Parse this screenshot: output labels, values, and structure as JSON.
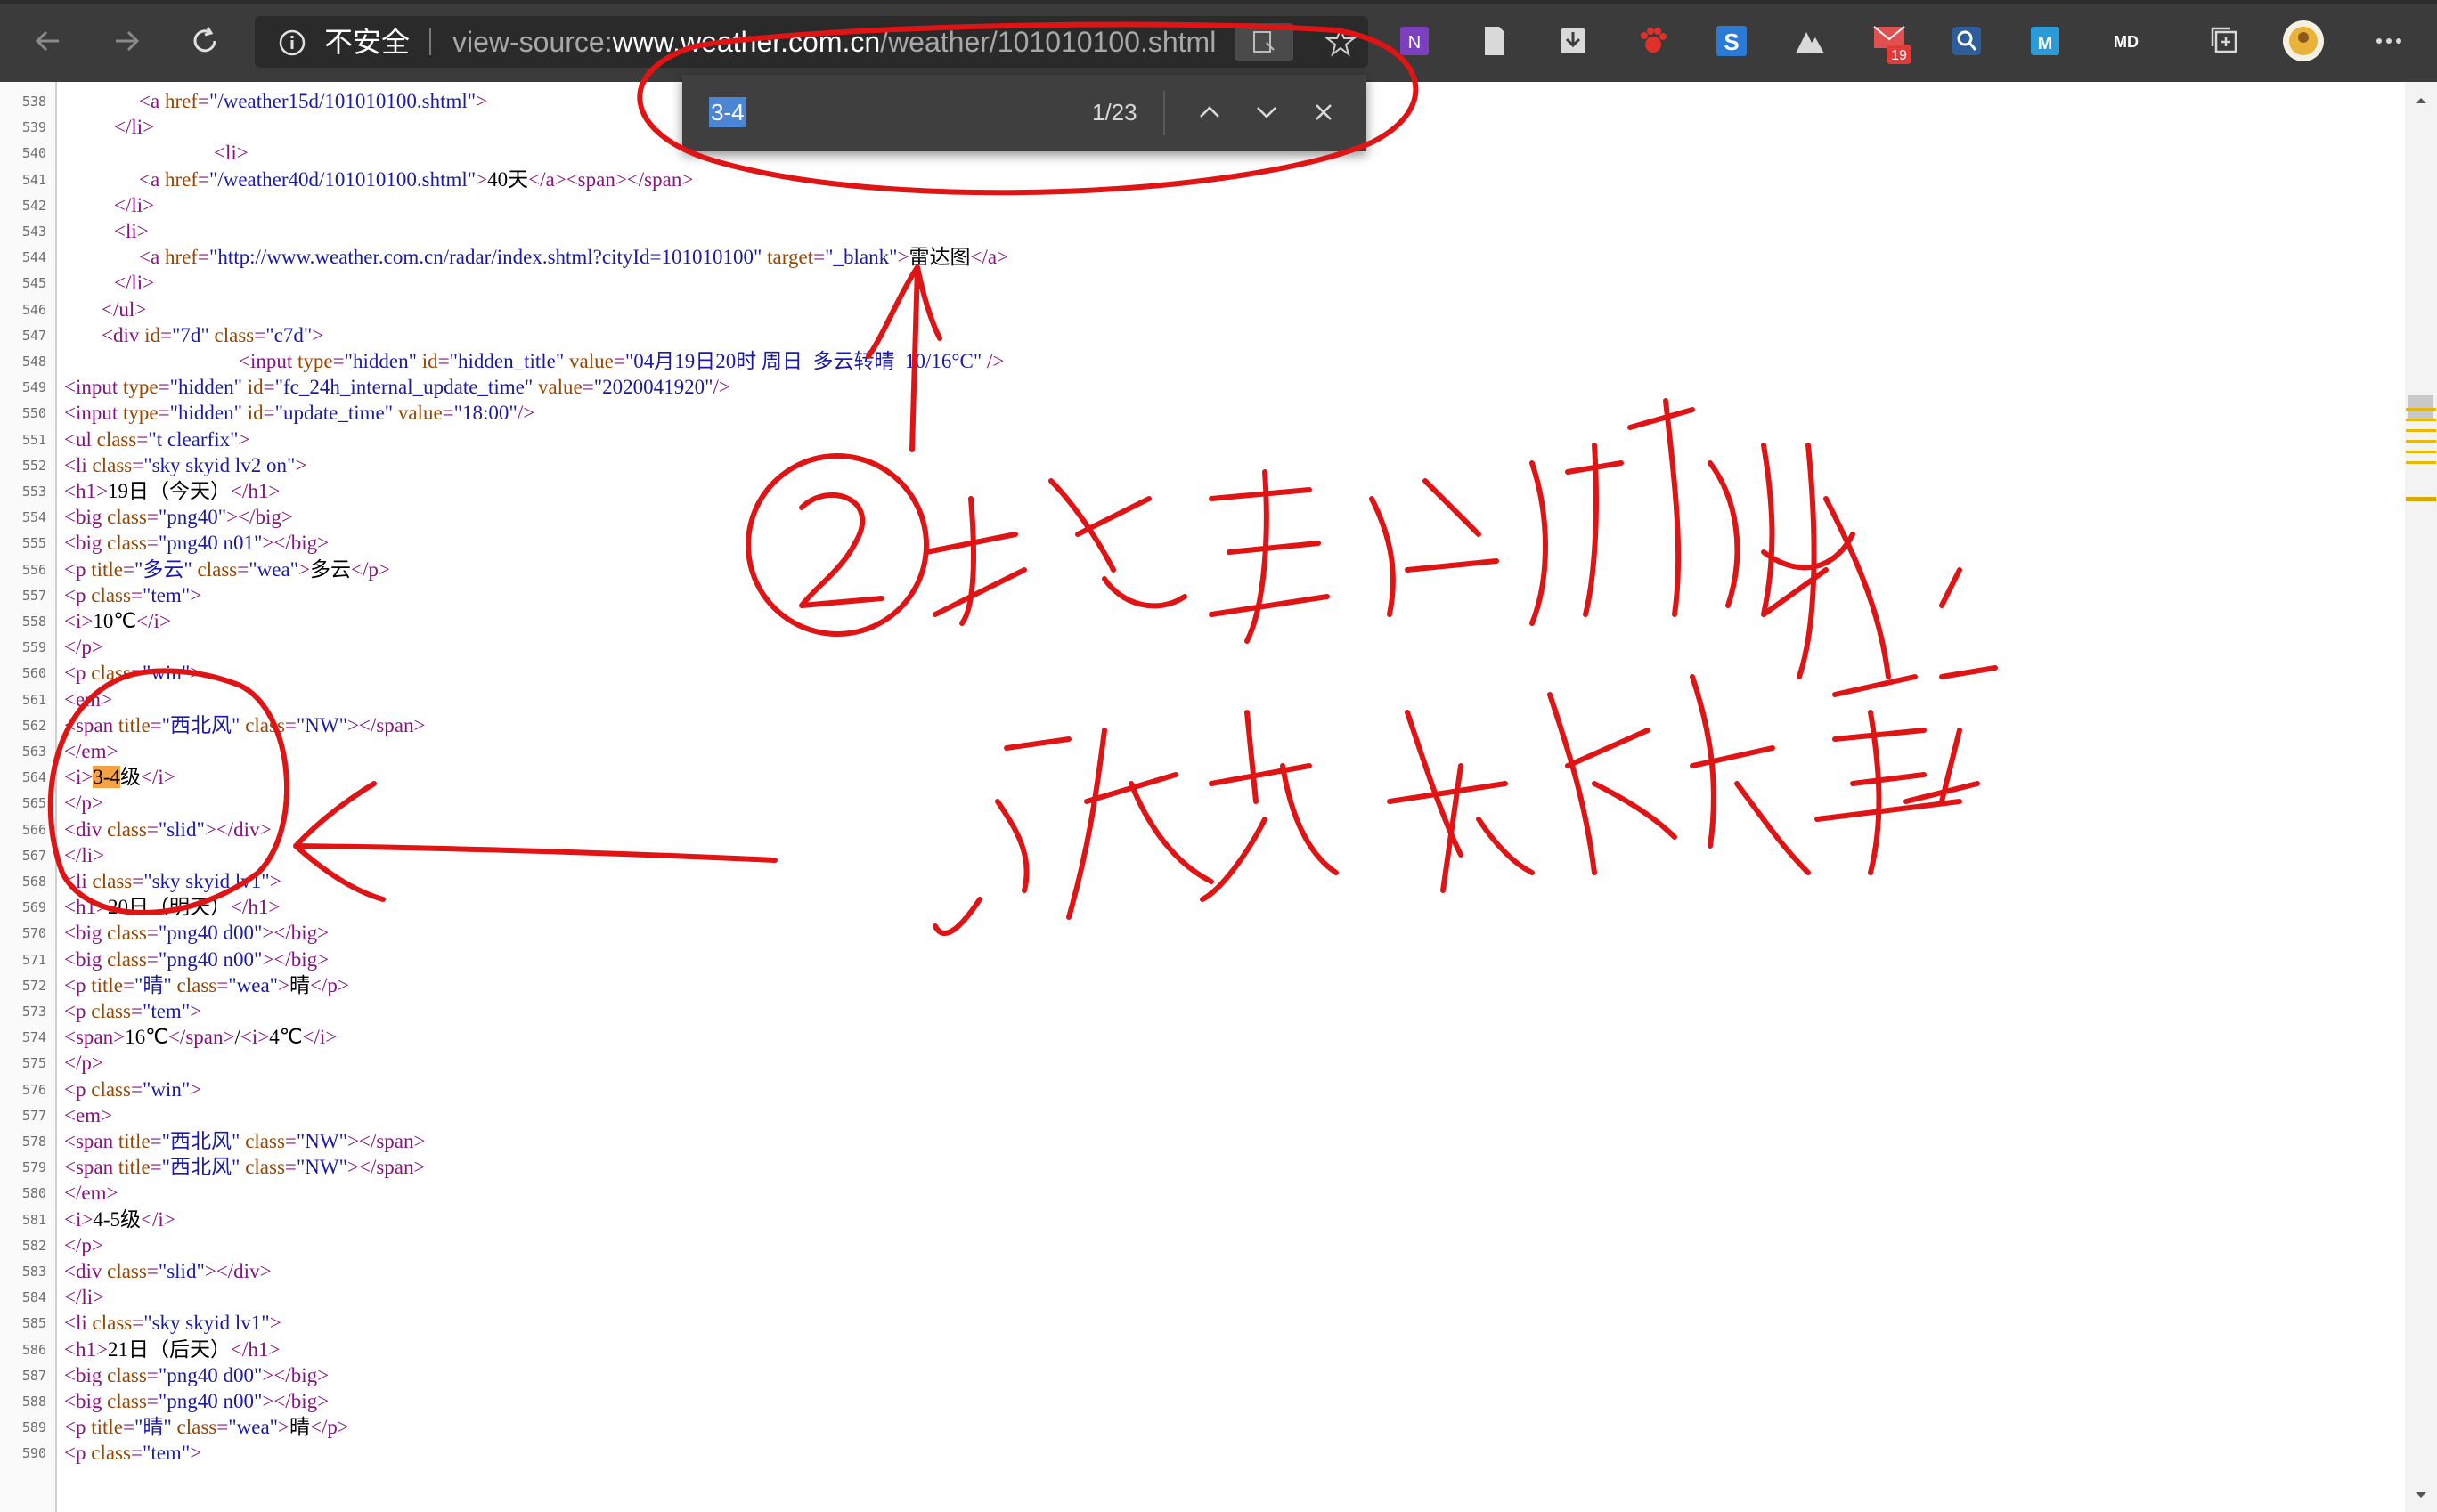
{
  "browser": {
    "security_label": "不安全",
    "url_prefix": "view-source:",
    "url_host": "www.weather.com.cn",
    "url_path": "/weather/101010100.shtml",
    "extensions": [
      {
        "name": "onenote-icon",
        "color": "#7b3fc0"
      },
      {
        "name": "document-icon",
        "color": "#d9d9d9"
      },
      {
        "name": "download-icon",
        "color": "#d9d9d9"
      },
      {
        "name": "paw-icon",
        "color": "#e0302a"
      },
      {
        "name": "s-app-icon",
        "color": "#2b7bd6"
      },
      {
        "name": "mountain-icon",
        "color": "#d9d9d9"
      },
      {
        "name": "mail-icon",
        "color": "#e05050",
        "badge": "19"
      },
      {
        "name": "search-ext-icon",
        "color": "#3a7fe0"
      },
      {
        "name": "m-app-icon",
        "color": "#2a9ad9"
      },
      {
        "name": "markdown-icon",
        "color": "#ffffff",
        "label": "MD"
      },
      {
        "name": "collections-icon",
        "color": "#d9d9d9"
      },
      {
        "name": "avatar",
        "color": "#e9b23a"
      },
      {
        "name": "more-icon",
        "color": "#d9d9d9"
      }
    ]
  },
  "find": {
    "query": "3-4",
    "count": "1/23"
  },
  "source_lines": [
    {
      "n": "538",
      "indent": 6,
      "parts": [
        [
          "tg",
          "<a "
        ],
        [
          "an",
          "href"
        ],
        [
          "tg",
          "="
        ],
        [
          "av",
          "\"/weather15d/101010100.shtml\""
        ],
        [
          "tg",
          ">"
        ]
      ]
    },
    {
      "n": "539",
      "indent": 4,
      "parts": [
        [
          "tg",
          "</li>"
        ]
      ]
    },
    {
      "n": "540",
      "indent": 12,
      "parts": [
        [
          "tg",
          "<li>"
        ]
      ]
    },
    {
      "n": "541",
      "indent": 6,
      "parts": [
        [
          "tg",
          "<a "
        ],
        [
          "an",
          "href"
        ],
        [
          "tg",
          "="
        ],
        [
          "av",
          "\"/weather40d/101010100.shtml\""
        ],
        [
          "tg",
          ">"
        ],
        [
          "tx",
          "40天"
        ],
        [
          "tg",
          "</a><span></span>"
        ]
      ]
    },
    {
      "n": "542",
      "indent": 4,
      "parts": [
        [
          "tg",
          "</li>"
        ]
      ]
    },
    {
      "n": "543",
      "indent": 4,
      "parts": [
        [
          "tg",
          "<li>"
        ]
      ]
    },
    {
      "n": "544",
      "indent": 6,
      "parts": [
        [
          "tg",
          "<a "
        ],
        [
          "an",
          "href"
        ],
        [
          "tg",
          "="
        ],
        [
          "av",
          "\"http://www.weather.com.cn/radar/index.shtml?cityId=101010100\""
        ],
        [
          "an",
          " target"
        ],
        [
          "tg",
          "="
        ],
        [
          "av",
          "\"_blank\""
        ],
        [
          "tg",
          ">"
        ],
        [
          "tx",
          "雷达图"
        ],
        [
          "tg",
          "</a>"
        ]
      ]
    },
    {
      "n": "545",
      "indent": 4,
      "parts": [
        [
          "tg",
          "</li>"
        ]
      ]
    },
    {
      "n": "546",
      "indent": 3,
      "parts": [
        [
          "tg",
          "</ul>"
        ]
      ]
    },
    {
      "n": "547",
      "indent": 3,
      "parts": [
        [
          "tg",
          "<div "
        ],
        [
          "an",
          "id"
        ],
        [
          "tg",
          "="
        ],
        [
          "av",
          "\"7d\""
        ],
        [
          "an",
          " class"
        ],
        [
          "tg",
          "="
        ],
        [
          "av",
          "\"c7d\""
        ],
        [
          "tg",
          ">"
        ]
      ]
    },
    {
      "n": "548",
      "indent": 14,
      "parts": [
        [
          "tg",
          "<input "
        ],
        [
          "an",
          "type"
        ],
        [
          "tg",
          "="
        ],
        [
          "av",
          "\"hidden\""
        ],
        [
          "an",
          " id"
        ],
        [
          "tg",
          "="
        ],
        [
          "av",
          "\"hidden_title\""
        ],
        [
          "an",
          " value"
        ],
        [
          "tg",
          "="
        ],
        [
          "av",
          "\"04月19日20时 周日  多云转晴  10/16°C\""
        ],
        [
          "tg",
          " />"
        ]
      ]
    },
    {
      "n": "549",
      "indent": 0,
      "parts": [
        [
          "tg",
          "<input "
        ],
        [
          "an",
          "type"
        ],
        [
          "tg",
          "="
        ],
        [
          "av",
          "\"hidden\""
        ],
        [
          "an",
          " id"
        ],
        [
          "tg",
          "="
        ],
        [
          "av",
          "\"fc_24h_internal_update_time\""
        ],
        [
          "an",
          " value"
        ],
        [
          "tg",
          "="
        ],
        [
          "av",
          "\"2020041920\""
        ],
        [
          "tg",
          "/>"
        ]
      ]
    },
    {
      "n": "550",
      "indent": 0,
      "parts": [
        [
          "tg",
          "<input "
        ],
        [
          "an",
          "type"
        ],
        [
          "tg",
          "="
        ],
        [
          "av",
          "\"hidden\""
        ],
        [
          "an",
          " id"
        ],
        [
          "tg",
          "="
        ],
        [
          "av",
          "\"update_time\""
        ],
        [
          "an",
          " value"
        ],
        [
          "tg",
          "="
        ],
        [
          "av",
          "\"18:00\""
        ],
        [
          "tg",
          "/>"
        ]
      ]
    },
    {
      "n": "551",
      "indent": 0,
      "parts": [
        [
          "tg",
          "<ul "
        ],
        [
          "an",
          "class"
        ],
        [
          "tg",
          "="
        ],
        [
          "av",
          "\"t clearfix\""
        ],
        [
          "tg",
          ">"
        ]
      ]
    },
    {
      "n": "552",
      "indent": 0,
      "parts": [
        [
          "tg",
          "<li "
        ],
        [
          "an",
          "class"
        ],
        [
          "tg",
          "="
        ],
        [
          "av",
          "\"sky skyid lv2 on\""
        ],
        [
          "tg",
          ">"
        ]
      ]
    },
    {
      "n": "553",
      "indent": 0,
      "parts": [
        [
          "tg",
          "<h1>"
        ],
        [
          "tx",
          "19日（今天）"
        ],
        [
          "tg",
          "</h1>"
        ]
      ]
    },
    {
      "n": "554",
      "indent": 0,
      "parts": [
        [
          "tg",
          "<big "
        ],
        [
          "an",
          "class"
        ],
        [
          "tg",
          "="
        ],
        [
          "av",
          "\"png40\""
        ],
        [
          "tg",
          "></big>"
        ]
      ]
    },
    {
      "n": "555",
      "indent": 0,
      "parts": [
        [
          "tg",
          "<big "
        ],
        [
          "an",
          "class"
        ],
        [
          "tg",
          "="
        ],
        [
          "av",
          "\"png40 n01\""
        ],
        [
          "tg",
          "></big>"
        ]
      ]
    },
    {
      "n": "556",
      "indent": 0,
      "parts": [
        [
          "tg",
          "<p "
        ],
        [
          "an",
          "title"
        ],
        [
          "tg",
          "="
        ],
        [
          "av",
          "\"多云\""
        ],
        [
          "an",
          " class"
        ],
        [
          "tg",
          "="
        ],
        [
          "av",
          "\"wea\""
        ],
        [
          "tg",
          ">"
        ],
        [
          "tx",
          "多云"
        ],
        [
          "tg",
          "</p>"
        ]
      ]
    },
    {
      "n": "557",
      "indent": 0,
      "parts": [
        [
          "tg",
          "<p "
        ],
        [
          "an",
          "class"
        ],
        [
          "tg",
          "="
        ],
        [
          "av",
          "\"tem\""
        ],
        [
          "tg",
          ">"
        ]
      ]
    },
    {
      "n": "558",
      "indent": 0,
      "parts": [
        [
          "tg",
          "<i>"
        ],
        [
          "tx",
          "10℃"
        ],
        [
          "tg",
          "</i>"
        ]
      ]
    },
    {
      "n": "559",
      "indent": 0,
      "parts": [
        [
          "tg",
          "</p>"
        ]
      ]
    },
    {
      "n": "560",
      "indent": 0,
      "parts": [
        [
          "tg",
          "<p "
        ],
        [
          "an",
          "class"
        ],
        [
          "tg",
          "="
        ],
        [
          "av",
          "\"win\""
        ],
        [
          "tg",
          ">"
        ]
      ]
    },
    {
      "n": "561",
      "indent": 0,
      "parts": [
        [
          "tg",
          "<em>"
        ]
      ]
    },
    {
      "n": "562",
      "indent": 0,
      "parts": [
        [
          "tg",
          "<span "
        ],
        [
          "an",
          "title"
        ],
        [
          "tg",
          "="
        ],
        [
          "av",
          "\"西北风\""
        ],
        [
          "an",
          " class"
        ],
        [
          "tg",
          "="
        ],
        [
          "av",
          "\"NW\""
        ],
        [
          "tg",
          "></span>"
        ]
      ]
    },
    {
      "n": "563",
      "indent": 0,
      "parts": [
        [
          "tg",
          "</em>"
        ]
      ]
    },
    {
      "n": "564",
      "indent": 0,
      "parts": [
        [
          "tg",
          "<i>"
        ],
        [
          "hl",
          "3-4"
        ],
        [
          "tx",
          "级"
        ],
        [
          "tg",
          "</i>"
        ]
      ]
    },
    {
      "n": "565",
      "indent": 0,
      "parts": [
        [
          "tg",
          "</p>"
        ]
      ]
    },
    {
      "n": "566",
      "indent": 0,
      "parts": [
        [
          "tg",
          "<div "
        ],
        [
          "an",
          "class"
        ],
        [
          "tg",
          "="
        ],
        [
          "av",
          "\"slid\""
        ],
        [
          "tg",
          "></div>"
        ]
      ]
    },
    {
      "n": "567",
      "indent": 0,
      "parts": [
        [
          "tg",
          "</li>"
        ]
      ]
    },
    {
      "n": "568",
      "indent": 0,
      "parts": [
        [
          "tg",
          "<li "
        ],
        [
          "an",
          "class"
        ],
        [
          "tg",
          "="
        ],
        [
          "av",
          "\"sky skyid lv1\""
        ],
        [
          "tg",
          ">"
        ]
      ]
    },
    {
      "n": "569",
      "indent": 0,
      "parts": [
        [
          "tg",
          "<h1>"
        ],
        [
          "tx",
          "20日（明天）"
        ],
        [
          "tg",
          "</h1>"
        ]
      ]
    },
    {
      "n": "570",
      "indent": 0,
      "parts": [
        [
          "tg",
          "<big "
        ],
        [
          "an",
          "class"
        ],
        [
          "tg",
          "="
        ],
        [
          "av",
          "\"png40 d00\""
        ],
        [
          "tg",
          "></big>"
        ]
      ]
    },
    {
      "n": "571",
      "indent": 0,
      "parts": [
        [
          "tg",
          "<big "
        ],
        [
          "an",
          "class"
        ],
        [
          "tg",
          "="
        ],
        [
          "av",
          "\"png40 n00\""
        ],
        [
          "tg",
          "></big>"
        ]
      ]
    },
    {
      "n": "572",
      "indent": 0,
      "parts": [
        [
          "tg",
          "<p "
        ],
        [
          "an",
          "title"
        ],
        [
          "tg",
          "="
        ],
        [
          "av",
          "\"晴\""
        ],
        [
          "an",
          " class"
        ],
        [
          "tg",
          "="
        ],
        [
          "av",
          "\"wea\""
        ],
        [
          "tg",
          ">"
        ],
        [
          "tx",
          "晴"
        ],
        [
          "tg",
          "</p>"
        ]
      ]
    },
    {
      "n": "573",
      "indent": 0,
      "parts": [
        [
          "tg",
          "<p "
        ],
        [
          "an",
          "class"
        ],
        [
          "tg",
          "="
        ],
        [
          "av",
          "\"tem\""
        ],
        [
          "tg",
          ">"
        ]
      ]
    },
    {
      "n": "574",
      "indent": 0,
      "parts": [
        [
          "tg",
          "<span>"
        ],
        [
          "tx",
          "16℃"
        ],
        [
          "tg",
          "</span>"
        ],
        [
          "tx",
          "/"
        ],
        [
          "tg",
          "<i>"
        ],
        [
          "tx",
          "4℃"
        ],
        [
          "tg",
          "</i>"
        ]
      ]
    },
    {
      "n": "575",
      "indent": 0,
      "parts": [
        [
          "tg",
          "</p>"
        ]
      ]
    },
    {
      "n": "576",
      "indent": 0,
      "parts": [
        [
          "tg",
          "<p "
        ],
        [
          "an",
          "class"
        ],
        [
          "tg",
          "="
        ],
        [
          "av",
          "\"win\""
        ],
        [
          "tg",
          ">"
        ]
      ]
    },
    {
      "n": "577",
      "indent": 0,
      "parts": [
        [
          "tg",
          "<em>"
        ]
      ]
    },
    {
      "n": "578",
      "indent": 0,
      "parts": [
        [
          "tg",
          "<span "
        ],
        [
          "an",
          "title"
        ],
        [
          "tg",
          "="
        ],
        [
          "av",
          "\"西北风\""
        ],
        [
          "an",
          " class"
        ],
        [
          "tg",
          "="
        ],
        [
          "av",
          "\"NW\""
        ],
        [
          "tg",
          "></span>"
        ]
      ]
    },
    {
      "n": "579",
      "indent": 0,
      "parts": [
        [
          "tg",
          "<span "
        ],
        [
          "an",
          "title"
        ],
        [
          "tg",
          "="
        ],
        [
          "av",
          "\"西北风\""
        ],
        [
          "an",
          " class"
        ],
        [
          "tg",
          "="
        ],
        [
          "av",
          "\"NW\""
        ],
        [
          "tg",
          "></span>"
        ]
      ]
    },
    {
      "n": "580",
      "indent": 0,
      "parts": [
        [
          "tg",
          "</em>"
        ]
      ]
    },
    {
      "n": "581",
      "indent": 0,
      "parts": [
        [
          "tg",
          "<i>"
        ],
        [
          "tx",
          "4-5级"
        ],
        [
          "tg",
          "</i>"
        ]
      ]
    },
    {
      "n": "582",
      "indent": 0,
      "parts": [
        [
          "tg",
          "</p>"
        ]
      ]
    },
    {
      "n": "583",
      "indent": 0,
      "parts": [
        [
          "tg",
          "<div "
        ],
        [
          "an",
          "class"
        ],
        [
          "tg",
          "="
        ],
        [
          "av",
          "\"slid\""
        ],
        [
          "tg",
          "></div>"
        ]
      ]
    },
    {
      "n": "584",
      "indent": 0,
      "parts": [
        [
          "tg",
          "</li>"
        ]
      ]
    },
    {
      "n": "585",
      "indent": 0,
      "parts": [
        [
          "tg",
          "<li "
        ],
        [
          "an",
          "class"
        ],
        [
          "tg",
          "="
        ],
        [
          "av",
          "\"sky skyid lv1\""
        ],
        [
          "tg",
          ">"
        ]
      ]
    },
    {
      "n": "586",
      "indent": 0,
      "parts": [
        [
          "tg",
          "<h1>"
        ],
        [
          "tx",
          "21日（后天）"
        ],
        [
          "tg",
          "</h1>"
        ]
      ]
    },
    {
      "n": "587",
      "indent": 0,
      "parts": [
        [
          "tg",
          "<big "
        ],
        [
          "an",
          "class"
        ],
        [
          "tg",
          "="
        ],
        [
          "av",
          "\"png40 d00\""
        ],
        [
          "tg",
          "></big>"
        ]
      ]
    },
    {
      "n": "588",
      "indent": 0,
      "parts": [
        [
          "tg",
          "<big "
        ],
        [
          "an",
          "class"
        ],
        [
          "tg",
          "="
        ],
        [
          "av",
          "\"png40 n00\""
        ],
        [
          "tg",
          "></big>"
        ]
      ]
    },
    {
      "n": "589",
      "indent": 0,
      "parts": [
        [
          "tg",
          "<p "
        ],
        [
          "an",
          "title"
        ],
        [
          "tg",
          "="
        ],
        [
          "av",
          "\"晴\""
        ],
        [
          "an",
          " class"
        ],
        [
          "tg",
          "="
        ],
        [
          "av",
          "\"wea\""
        ],
        [
          "tg",
          ">"
        ],
        [
          "tx",
          "晴"
        ],
        [
          "tg",
          "</p>"
        ]
      ]
    },
    {
      "n": "590",
      "indent": 0,
      "parts": [
        [
          "tg",
          "<p "
        ],
        [
          "an",
          "class"
        ],
        [
          "tg",
          "="
        ],
        [
          "av",
          "\"tem\""
        ],
        [
          "tg",
          ">"
        ]
      ]
    }
  ],
  "annotation": {
    "color": "#e01414"
  }
}
